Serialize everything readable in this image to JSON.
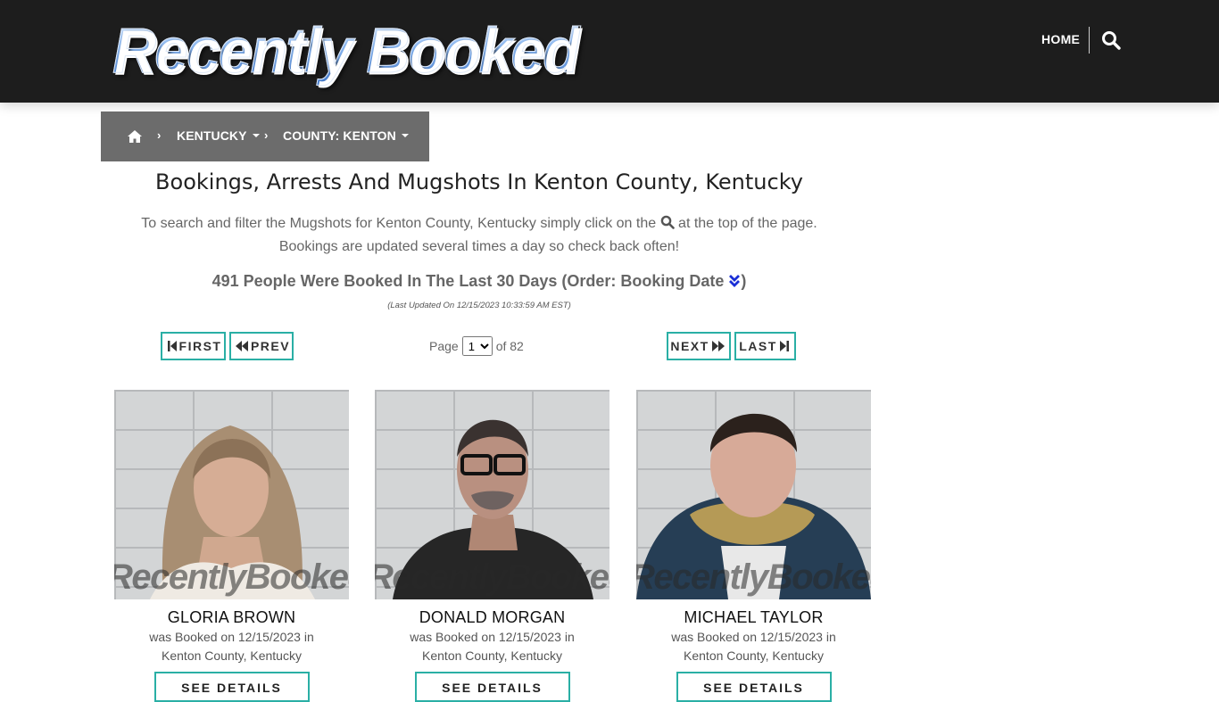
{
  "header": {
    "logo_text": "Recently Booked",
    "nav_home": "HOME",
    "search_icon": "search-icon"
  },
  "breadcrumb": {
    "home_icon": "home-icon",
    "separator": "›",
    "state": "KENTUCKY",
    "county": "COUNTY: KENTON"
  },
  "main": {
    "title": "Bookings, Arrests And Mugshots In Kenton County, Kentucky",
    "desc_line1_before": "To search and filter the Mugshots for Kenton County, Kentucky simply click on the",
    "desc_line1_after": "at the top of the page.",
    "desc_line2": "Bookings are updated several times a day so check back often!",
    "count_text": "491 People Were Booked In The Last 30 Days (Order: Booking Date",
    "count_close": ")",
    "last_updated": "(Last Updated On 12/15/2023 10:33:59 AM EST)"
  },
  "pagination": {
    "first": "FIRST",
    "prev": "PREV",
    "next": "NEXT",
    "last": "LAST",
    "page_label": "Page",
    "current_page": "1",
    "of_label": "of 82"
  },
  "bookings": [
    {
      "name": "GLORIA BROWN",
      "booked_line": "was Booked on 12/15/2023 in",
      "location": "Kenton County, Kentucky",
      "watermark": "RecentlyBooked.com",
      "details_label": "SEE DETAILS"
    },
    {
      "name": "DONALD MORGAN",
      "booked_line": "was Booked on 12/15/2023 in",
      "location": "Kenton County, Kentucky",
      "watermark": "RecentlyBooked.com",
      "details_label": "SEE DETAILS"
    },
    {
      "name": "MICHAEL TAYLOR",
      "booked_line": "was Booked on 12/15/2023 in",
      "location": "Kenton County, Kentucky",
      "watermark": "RecentlyBooked.com",
      "details_label": "SEE DETAILS"
    }
  ],
  "colors": {
    "header_bg": "#1d1d1d",
    "breadcrumb_bg": "#6c6c6c",
    "accent_teal": "#2aafa5",
    "order_icon_blue": "#1a2fd6"
  }
}
